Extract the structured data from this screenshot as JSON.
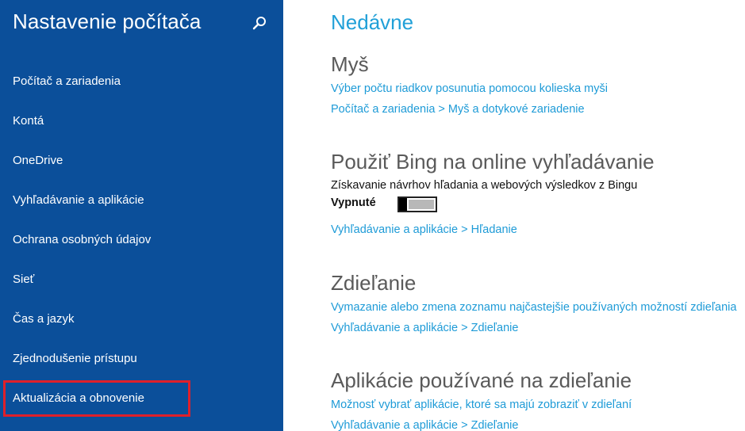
{
  "sidebar": {
    "title": "Nastavenie počítača",
    "search_icon": "search-icon",
    "items": [
      {
        "label": "Počítač a zariadenia"
      },
      {
        "label": "Kontá"
      },
      {
        "label": "OneDrive"
      },
      {
        "label": "Vyhľadávanie a aplikácie"
      },
      {
        "label": "Ochrana osobných údajov"
      },
      {
        "label": "Sieť"
      },
      {
        "label": "Čas a jazyk"
      },
      {
        "label": "Zjednodušenie prístupu"
      },
      {
        "label": "Aktualizácia a obnovenie",
        "highlighted": true
      }
    ]
  },
  "main": {
    "title": "Nedávne",
    "sections": [
      {
        "heading": "Myš",
        "links": [
          "Výber počtu riadkov posunutia pomocou kolieska myši",
          "Počítač a zariadenia > Myš a dotykové zariadenie"
        ]
      },
      {
        "heading": "Použiť Bing na online vyhľadávanie",
        "description": "Získavanie návrhov hľadania a webových výsledkov z Bingu",
        "toggle_label": "Vypnuté",
        "toggle_on": false,
        "links": [
          "Vyhľadávanie a aplikácie > Hľadanie"
        ]
      },
      {
        "heading": "Zdieľanie",
        "links": [
          "Vymazanie alebo zmena zoznamu najčastejšie používaných možností zdieľania",
          "Vyhľadávanie a aplikácie > Zdieľanie"
        ]
      },
      {
        "heading": "Aplikácie používané na zdieľanie",
        "links": [
          "Možnosť vybrať aplikácie, ktoré sa majú zobraziť v zdieľaní",
          "Vyhľadávanie a aplikácie > Zdieľanie"
        ]
      }
    ]
  },
  "colors": {
    "sidebar_bg": "#0b4f9a",
    "accent": "#1e9bd7",
    "highlight_box": "#e0202a"
  }
}
